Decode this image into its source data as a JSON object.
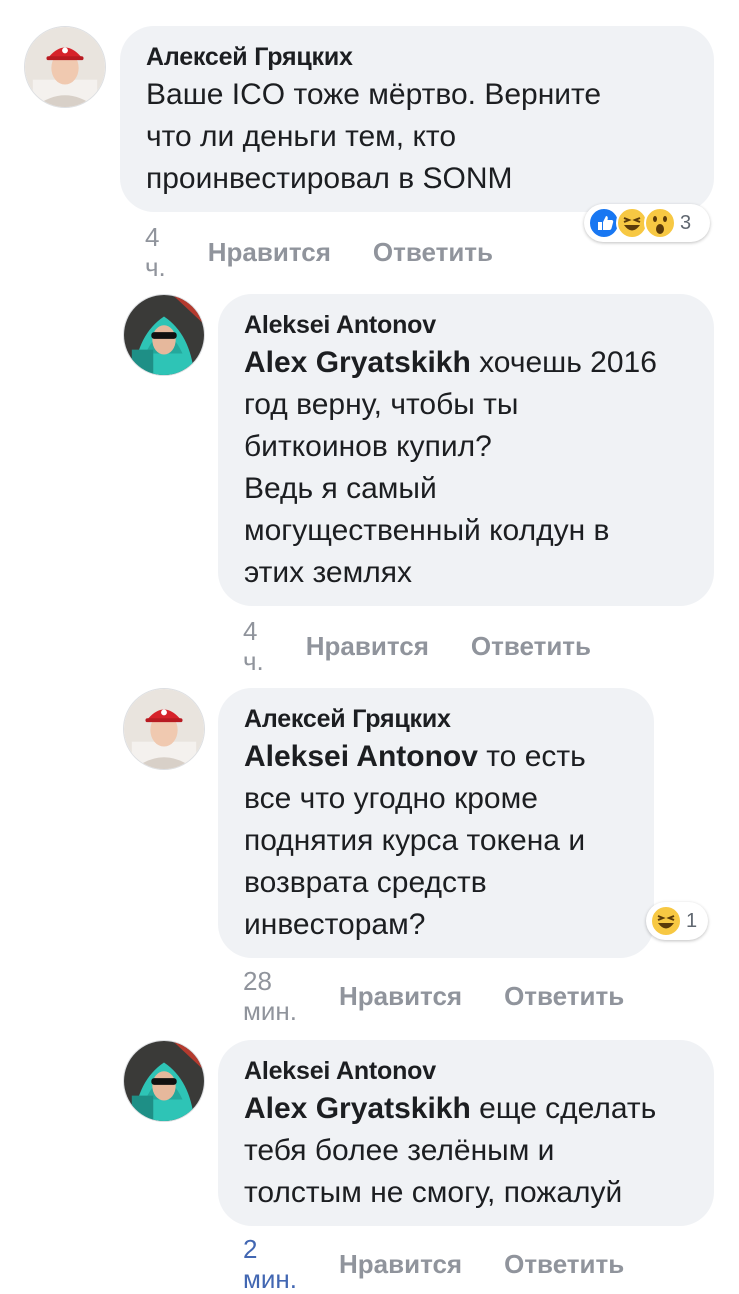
{
  "comments": [
    {
      "author": "Алексей Гряцких",
      "mention": "",
      "text": "Ваше ICO тоже мёртво. Верните\nчто ли деньги тем, кто\nпроинвестировал в SONM",
      "time": "4 ч.",
      "like": "Нравится",
      "reply": "Ответить",
      "reactions": {
        "icons": [
          "like-icon",
          "haha-icon",
          "wow-icon"
        ],
        "count": "3"
      }
    },
    {
      "author": "Aleksei Antonov",
      "mention": "Alex  Gryatskikh",
      "text": " хочешь 2016\nгод верну, чтобы ты\nбиткоинов купил?\nВедь я самый\nмогущественный колдун в\nэтих землях",
      "time": "4 ч.",
      "like": "Нравится",
      "reply": "Ответить"
    },
    {
      "author": "Алексей Гряцких",
      "mention": "Aleksei Antonov",
      "text": " то есть\nвсе что угодно кроме\nподнятия курса токена и\nвозврата средств\nинвесторам?",
      "time": "28 мин.",
      "like": "Нравится",
      "reply": "Ответить",
      "reactions": {
        "icons": [
          "haha-icon"
        ],
        "count": "1"
      }
    },
    {
      "author": "Aleksei Antonov",
      "mention": "Alex  Gryatskikh",
      "text": " еще сделать\nтебя более зелёным и\nтолстым не смогу, пожалуй",
      "time": "2 мин.",
      "like": "Нравится",
      "reply": "Ответить"
    }
  ],
  "colors": {
    "bubble": "#f0f2f5",
    "action_gray": "#90949c",
    "time_recent_blue": "#4267b2",
    "like_blue": "#1877f2",
    "emoji_yellow": "#f7c843"
  }
}
